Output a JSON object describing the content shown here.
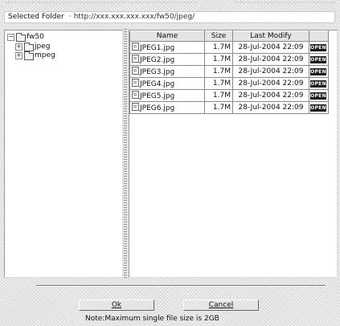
{
  "header": {
    "label": "Selected Folder",
    "path": "· http://xxx.xxx.xxx.xxx/fw50/jpeg/"
  },
  "tree": {
    "root": {
      "toggle": "−",
      "label": "fw50",
      "icon": "folder-icon"
    },
    "children": [
      {
        "toggle": "+",
        "label": "jpeg",
        "icon": "folder-icon"
      },
      {
        "toggle": "+",
        "label": "mpeg",
        "icon": "folder-icon"
      }
    ]
  },
  "files": {
    "columns": [
      "Name",
      "Size",
      "Last Modify",
      ""
    ],
    "action_label": "OPEN",
    "rows": [
      {
        "name": "JPEG1.jpg",
        "size": "1.7M",
        "modified": "28-Jul-2004 22:09"
      },
      {
        "name": "JPEG2.jpg",
        "size": "1.7M",
        "modified": "28-Jul-2004 22:09"
      },
      {
        "name": "JPEG3.jpg",
        "size": "1.7M",
        "modified": "28-Jul-2004 22:09"
      },
      {
        "name": "JPEG4.jpg",
        "size": "1.7M",
        "modified": "28-Jul-2004 22:09"
      },
      {
        "name": "JPEG5.jpg",
        "size": "1.7M",
        "modified": "28-Jul-2004 22:09"
      },
      {
        "name": "JPEG6.jpg",
        "size": "1.7M",
        "modified": "28-Jul-2004 22:09"
      }
    ]
  },
  "buttons": {
    "ok": "Ok",
    "cancel": "Cancel"
  },
  "note": "Note:Maximum single file size is 2GB",
  "colors": {
    "open_button_bg": "#1a1a1a",
    "panel_bg": "#ffffff",
    "dither_bg": "#e6e6e6"
  }
}
